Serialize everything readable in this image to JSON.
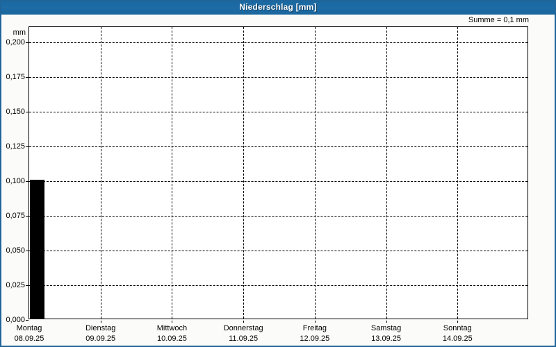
{
  "window": {
    "title": "Niederschlag [mm]"
  },
  "header": {
    "sum_label": "Summe = 0,1 mm"
  },
  "chart_data": {
    "type": "bar",
    "title": "Niederschlag [mm]",
    "unit_label": "mm",
    "sum_label": "Summe = 0,1 mm",
    "ylabel": "mm",
    "ylim": [
      0,
      0.211
    ],
    "ytick_interval": 0.025,
    "grid": "dashed",
    "legend": "none",
    "yticks": [
      {
        "label": "0,200",
        "value": 0.2
      },
      {
        "label": "0,175",
        "value": 0.175
      },
      {
        "label": "0,150",
        "value": 0.15
      },
      {
        "label": "0,125",
        "value": 0.125
      },
      {
        "label": "0,100",
        "value": 0.1
      },
      {
        "label": "0,075",
        "value": 0.075
      },
      {
        "label": "0,050",
        "value": 0.05
      },
      {
        "label": "0,025",
        "value": 0.025
      },
      {
        "label": "0,000",
        "value": 0.0
      }
    ],
    "days": [
      {
        "name": "Montag",
        "date": "08.09.25"
      },
      {
        "name": "Dienstag",
        "date": "09.09.25"
      },
      {
        "name": "Mittwoch",
        "date": "10.09.25"
      },
      {
        "name": "Donnerstag",
        "date": "11.09.25"
      },
      {
        "name": "Freitag",
        "date": "12.09.25"
      },
      {
        "name": "Samstag",
        "date": "13.09.25"
      },
      {
        "name": "Sonntag",
        "date": "14.09.25"
      }
    ],
    "bars": [
      {
        "day_index": 0,
        "day": "Montag",
        "date": "08.09.25",
        "value": 0.1
      }
    ],
    "total": {
      "value": 0.1
    }
  },
  "colors": {
    "titlebar": "#1d6aa3",
    "title_text": "#ffffff",
    "border": "#20659a",
    "background": "#fbfcf9",
    "plot_background": "#ffffff",
    "bar": "#000000",
    "grid": "#000000",
    "text": "#000000"
  }
}
